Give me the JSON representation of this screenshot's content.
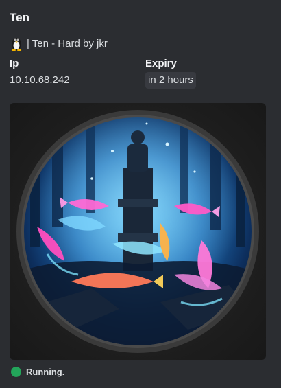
{
  "embed": {
    "title": "Ten",
    "subtitle": "| Ten - Hard by jkr",
    "os_icon": "linux-penguin-icon",
    "fields": {
      "ip": {
        "name": "Ip",
        "value": "10.10.68.242"
      },
      "expiry": {
        "name": "Expiry",
        "value": "in 2 hours"
      }
    },
    "image_alt": "machine-artwork"
  },
  "status": {
    "text": "Running.",
    "color": "#23a55a"
  }
}
